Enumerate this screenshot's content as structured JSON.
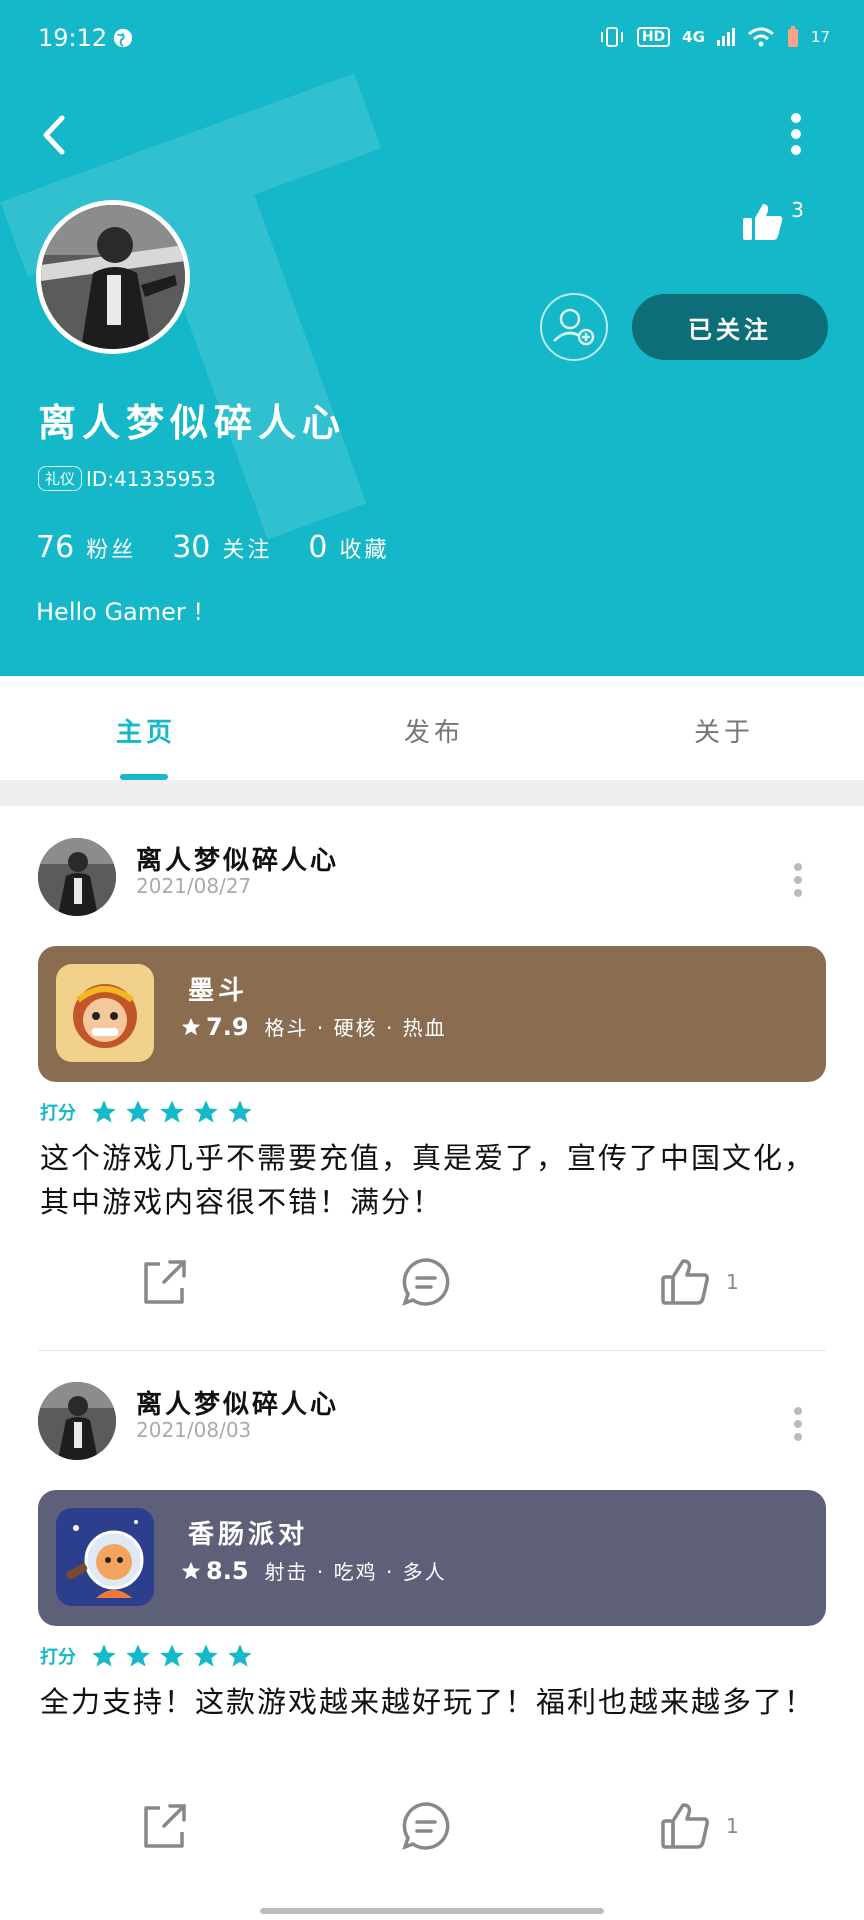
{
  "status_bar": {
    "time": "19:12",
    "network": "4G",
    "hd": "HD",
    "battery": "17"
  },
  "profile": {
    "username": "离人梦似碎人心",
    "tag": "礼仪",
    "id_text": "ID:41335953",
    "likes": "3",
    "follow_label": "已关注",
    "stats": [
      {
        "num": "76",
        "label": "粉丝"
      },
      {
        "num": "30",
        "label": "关注"
      },
      {
        "num": "0",
        "label": "收藏"
      }
    ],
    "bio": "Hello Gamer !"
  },
  "tabs": [
    {
      "label": "主页",
      "active": true
    },
    {
      "label": "发布",
      "active": false
    },
    {
      "label": "关于",
      "active": false
    }
  ],
  "posts": [
    {
      "author": "离人梦似碎人心",
      "date": "2021/08/27",
      "game": {
        "name": "墨斗",
        "score": "7.9",
        "tags": "格斗 · 硬核 · 热血",
        "color": "#8a6d50"
      },
      "rating_label": "打分",
      "stars": 5,
      "review": "这个游戏几乎不需要充值，真是爱了，宣传了中国文化，其中游戏内容很不错！满分！",
      "likes": "1"
    },
    {
      "author": "离人梦似碎人心",
      "date": "2021/08/03",
      "game": {
        "name": "香肠派对",
        "score": "8.5",
        "tags": "射击 · 吃鸡 · 多人",
        "color": "#5d6078"
      },
      "rating_label": "打分",
      "stars": 5,
      "review": "全力支持！这款游戏越来越好玩了！福利也越来越多了！",
      "likes": "1"
    }
  ],
  "colors": {
    "accent": "#14b8c9",
    "follow_bg": "#0d6d78"
  }
}
